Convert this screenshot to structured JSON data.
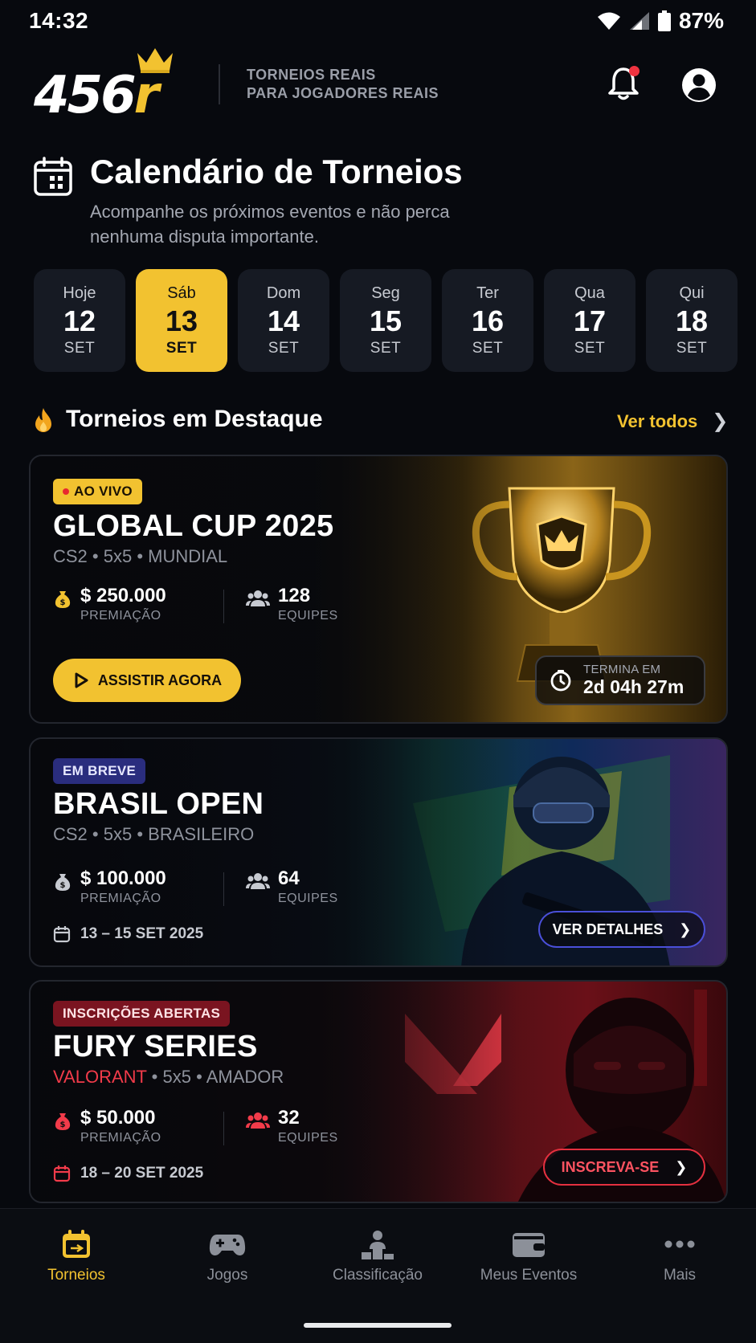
{
  "status": {
    "time": "14:32",
    "battery": "87%"
  },
  "header": {
    "logo_text": "456",
    "logo_r": "r",
    "tagline_1": "TORNEIOS REAIS",
    "tagline_2": "PARA JOGADORES REAIS"
  },
  "calendar": {
    "title": "Calendário de Torneios",
    "subtitle": "Acompanhe os próximos eventos e não perca nenhuma disputa importante.",
    "days": [
      {
        "name": "Hoje",
        "day": "12",
        "month": "SET"
      },
      {
        "name": "Sáb",
        "day": "13",
        "month": "SET"
      },
      {
        "name": "Dom",
        "day": "14",
        "month": "SET"
      },
      {
        "name": "Seg",
        "day": "15",
        "month": "SET"
      },
      {
        "name": "Ter",
        "day": "16",
        "month": "SET"
      },
      {
        "name": "Qua",
        "day": "17",
        "month": "SET"
      },
      {
        "name": "Qui",
        "day": "18",
        "month": "SET"
      }
    ],
    "selected_day": "13"
  },
  "featured": {
    "title": "Torneios em Destaque",
    "see_all": "Ver todos",
    "tournaments": [
      {
        "badge": "AO VIVO",
        "title": "GLOBAL CUP 2025",
        "game": "CS2",
        "format": "5x5",
        "scope": "MUNDIAL",
        "prize": "$ 250.000",
        "prize_label": "PREMIAÇÃO",
        "teams": "128",
        "teams_label": "EQUIPES",
        "cta": "ASSISTIR AGORA",
        "timer_label": "TERMINA EM",
        "timer_value": "2d 04h 27m"
      },
      {
        "badge": "EM BREVE",
        "title": "BRASIL OPEN",
        "game": "CS2",
        "format": "5x5",
        "scope": "BRASILEIRO",
        "prize": "$ 100.000",
        "prize_label": "PREMIAÇÃO",
        "teams": "64",
        "teams_label": "EQUIPES",
        "dates": "13 – 15 SET 2025",
        "cta": "VER DETALHES"
      },
      {
        "badge": "INSCRIÇÕES ABERTAS",
        "title": "FURY SERIES",
        "game": "VALORANT",
        "format": "5x5",
        "scope": "AMADOR",
        "prize": "$ 50.000",
        "prize_label": "PREMIAÇÃO",
        "teams": "32",
        "teams_label": "EQUIPES",
        "dates": "18 – 20 SET 2025",
        "cta": "INSCREVA-SE"
      }
    ]
  },
  "nav": {
    "items": [
      {
        "label": "Torneios",
        "icon": "calendar-icon"
      },
      {
        "label": "Jogos",
        "icon": "gamepad-icon"
      },
      {
        "label": "Classificação",
        "icon": "ranking-icon"
      },
      {
        "label": "Meus Eventos",
        "icon": "wallet-icon"
      },
      {
        "label": "Mais",
        "icon": "more-icon"
      }
    ],
    "active": "Torneios"
  },
  "colors": {
    "accent": "#f2c230",
    "live_dot": "#e8282f",
    "soon": "#2a2d7e",
    "open": "#e4303f",
    "background": "#07090e"
  }
}
